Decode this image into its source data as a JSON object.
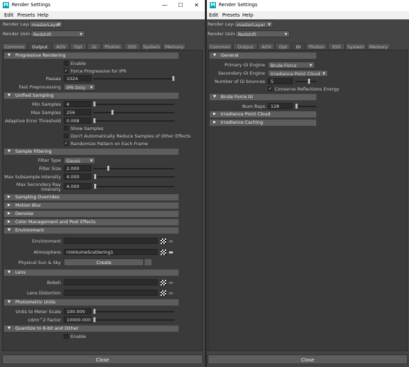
{
  "left": {
    "window_title": "Render Settings",
    "menu": [
      "Edit",
      "Presets",
      "Help"
    ],
    "render_layer_label": "Render Layer",
    "render_layer_value": "masterLayer",
    "render_using_label": "Render Using",
    "render_using_value": "Redshift",
    "tabs": [
      "Common",
      "Output",
      "AOV",
      "Opt",
      "GI",
      "Photon",
      "SSS",
      "System",
      "Memory"
    ],
    "active_tab": "Output",
    "progressive": {
      "header": "Progressive Rendering",
      "enable": "Enable",
      "force_ipr": "Force Progressive for IPR",
      "passes_label": "Passes",
      "passes_value": "1024",
      "fast_label": "Fast Preprocessing",
      "fast_value": "IPR Only"
    },
    "unified": {
      "header": "Unified Sampling",
      "min_label": "Min Samples",
      "min_value": "4",
      "max_label": "Max Samples",
      "max_value": "256",
      "aet_label": "Adaptive Error Threshold",
      "aet_value": "0.008",
      "show_samples": "Show Samples",
      "dont_reduce": "Don't Automatically Reduce Samples of Other Effects",
      "randomize": "Randomize Pattern on Each Frame"
    },
    "filtering": {
      "header": "Sample Filtering",
      "type_label": "Filter Type",
      "type_value": "Gauss",
      "size_label": "Filter Size",
      "size_value": "2.000",
      "msi_label": "Max Subsample Intensity",
      "msi_value": "4.000",
      "msri_label_1": "Max Secondary Ray",
      "msri_label_2": "Intensity",
      "msri_value": "4.000"
    },
    "collapsed": [
      "Sampling Overrides",
      "Motion Blur",
      "Denoise",
      "Color Management and Post Effects"
    ],
    "environment": {
      "header": "Environment",
      "env_label": "Environment",
      "env_value": "",
      "atm_label": "Atmosphere",
      "atm_value": "rsVolumeScattering1",
      "sun_label": "Physical Sun & Sky",
      "create": "Create"
    },
    "lens": {
      "header": "Lens",
      "bokeh_label": "Bokeh",
      "distortion_label": "Lens Distortion"
    },
    "photometric": {
      "header": "Photometric Units",
      "meter_label": "Units to Meter Scale",
      "meter_value": "100.000",
      "cd_label": "cd/m^2 Factor",
      "cd_value": "10000.000"
    },
    "dither": {
      "header": "Quantize to 8-bit and Dither",
      "enable": "Enable"
    },
    "close": "Close"
  },
  "right": {
    "window_title": "Render Settings",
    "menu": [
      "Edit",
      "Presets",
      "Help"
    ],
    "render_layer_label": "Render Layer",
    "render_layer_value": "masterLayer",
    "render_using_label": "Render Using",
    "render_using_value": "Redshift",
    "tabs": [
      "Common",
      "Output",
      "AOV",
      "Opt",
      "GI",
      "Photon",
      "SSS",
      "System",
      "Memory"
    ],
    "active_tab": "GI",
    "general": {
      "header": "General",
      "primary_label": "Primary GI Engine",
      "primary_value": "Brute Force",
      "secondary_label": "Secondary GI Engine",
      "secondary_value": "Irradiance Point Cloud",
      "bounces_label": "Number of GI bounces",
      "bounces_value": "5",
      "conserve": "Conserve Reflections Energy"
    },
    "brute": {
      "header": "Brute Force GI",
      "rays_label": "Num Rays",
      "rays_value": "128"
    },
    "collapsed": [
      "Irradiance Point Cloud",
      "Irradiance Caching"
    ],
    "close": "Close"
  },
  "colors": {
    "bg": "#444444",
    "header": "#5d5d5d",
    "field": "#2b2b2b",
    "accent": "#00a5b3"
  }
}
